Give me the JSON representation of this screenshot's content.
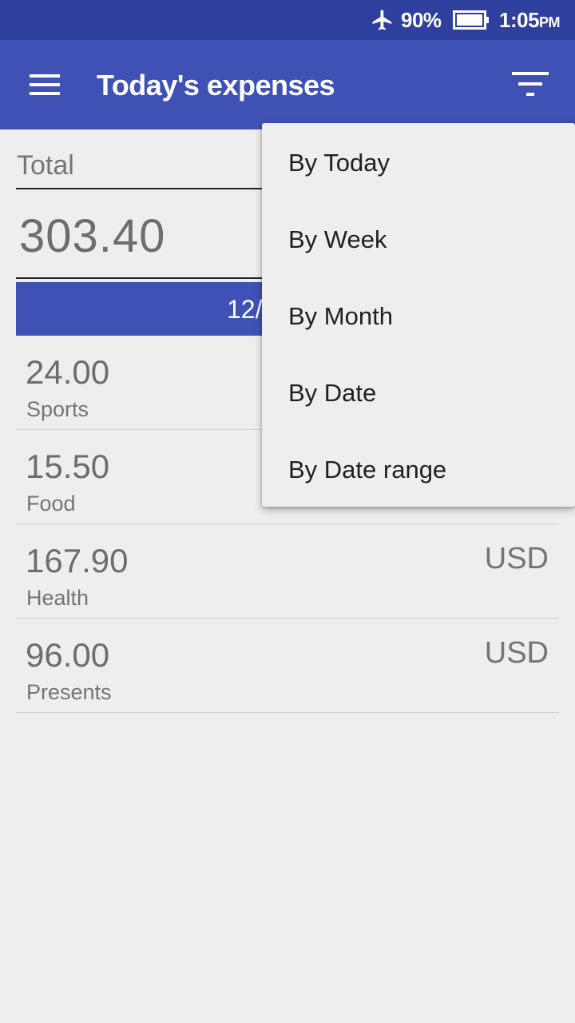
{
  "status_bar": {
    "battery_percent": "90%",
    "time": "1:05",
    "ampm": "PM",
    "icons": [
      "airplane-mode-icon",
      "battery-icon"
    ]
  },
  "app_bar": {
    "title": "Today's expenses",
    "icons": [
      "menu-icon",
      "filter-icon"
    ]
  },
  "summary": {
    "total_label": "Total",
    "total_value": "303.40",
    "date_text": "12/"
  },
  "expenses": [
    {
      "amount": "24.00",
      "category": "Sports",
      "currency": ""
    },
    {
      "amount": "15.50",
      "category": "Food",
      "currency": ""
    },
    {
      "amount": "167.90",
      "category": "Health",
      "currency": "USD"
    },
    {
      "amount": "96.00",
      "category": "Presents",
      "currency": "USD"
    }
  ],
  "filter_menu": {
    "items": [
      "By Today",
      "By Week",
      "By Month",
      "By Date",
      "By Date range"
    ]
  },
  "colors": {
    "status_bar": "#2f3f9e",
    "primary": "#3f51b5",
    "background": "#eeeeee"
  }
}
